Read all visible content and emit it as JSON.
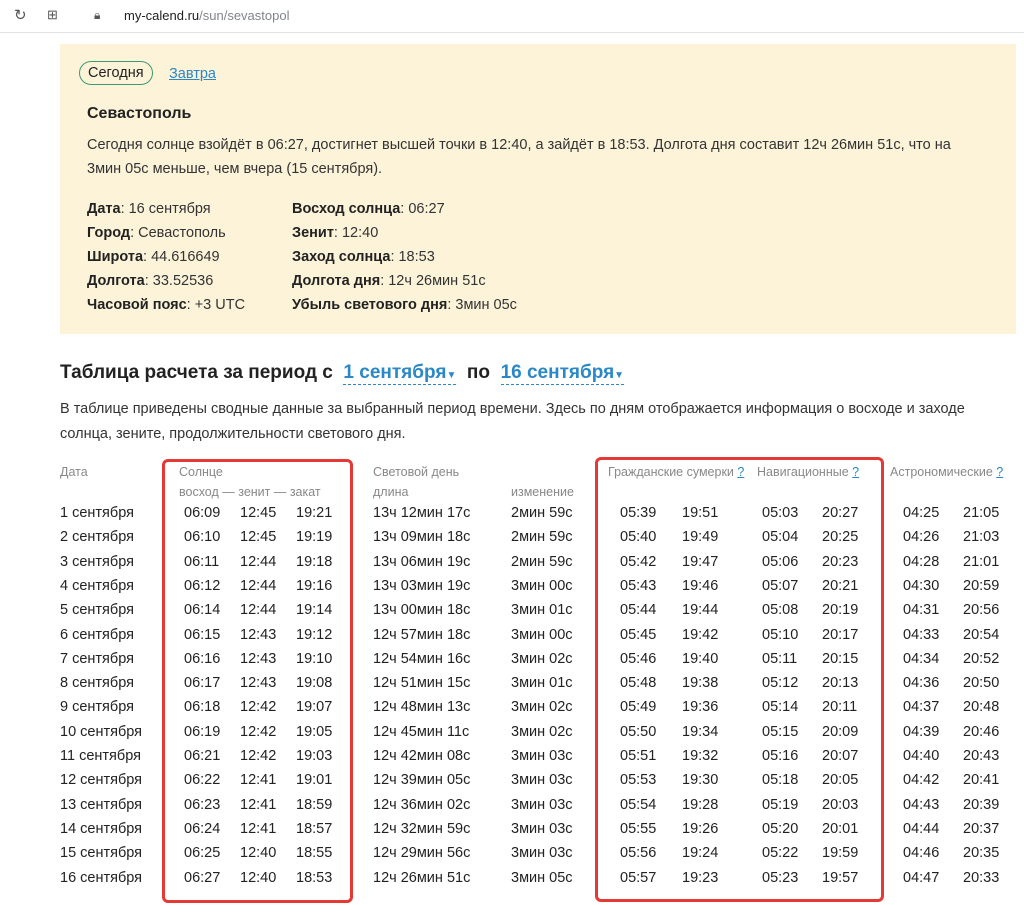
{
  "browser": {
    "url_host": "my-calend.ru",
    "url_path": "/sun/sevastopol"
  },
  "tabs": {
    "today": "Сегодня",
    "tomorrow": "Завтра"
  },
  "info": {
    "city": "Севастополь",
    "description": "Сегодня солнце взойдёт в 06:27, достигнет высшей точки в 12:40, а зайдёт в 18:53. Долгота дня составит 12ч 26мин 51с, что на 3мин 05с меньше, чем вчера (15 сентября).",
    "left": [
      {
        "label": "Дата",
        "value": ": 16 сентября"
      },
      {
        "label": "Город",
        "value": ": Севастополь"
      },
      {
        "label": "Широта",
        "value": ": 44.616649"
      },
      {
        "label": "Долгота",
        "value": ": 33.52536"
      },
      {
        "label": "Часовой пояс",
        "value": ": +3 UTC"
      }
    ],
    "right": [
      {
        "label": "Восход солнца",
        "value": ": 06:27"
      },
      {
        "label": "Зенит",
        "value": ": 12:40"
      },
      {
        "label": "Заход солнца",
        "value": ": 18:53"
      },
      {
        "label": "Долгота дня",
        "value": ": 12ч 26мин 51с"
      },
      {
        "label": "Убыль светового дня",
        "value": ": 3мин 05с"
      }
    ]
  },
  "period": {
    "title": "Таблица расчета за период с",
    "from": "1 сентября",
    "to_word": "по",
    "to": "16 сентября",
    "intro": "В таблице приведены сводные данные за выбранный период времени. Здесь по дням отображается информация о восходе и заходе солнца, зените, продолжительности светового дня."
  },
  "table_headers": {
    "date": "Дата",
    "sun": "Солнце",
    "sun_sub": "восход — зенит — закат",
    "daylight": "Световой день",
    "length": "длина",
    "change": "изменение",
    "civil": "Гражданские сумерки",
    "nautical": "Навигационные",
    "astronomical": "Астрономические",
    "help": "?"
  },
  "rows": [
    [
      "1 сентября",
      "06:09",
      "12:45",
      "19:21",
      "13ч 12мин 17с",
      "2мин 59с",
      "05:39",
      "19:51",
      "05:03",
      "20:27",
      "04:25",
      "21:05"
    ],
    [
      "2 сентября",
      "06:10",
      "12:45",
      "19:19",
      "13ч 09мин 18с",
      "2мин 59с",
      "05:40",
      "19:49",
      "05:04",
      "20:25",
      "04:26",
      "21:03"
    ],
    [
      "3 сентября",
      "06:11",
      "12:44",
      "19:18",
      "13ч 06мин 19с",
      "2мин 59с",
      "05:42",
      "19:47",
      "05:06",
      "20:23",
      "04:28",
      "21:01"
    ],
    [
      "4 сентября",
      "06:12",
      "12:44",
      "19:16",
      "13ч 03мин 19с",
      "3мин 00с",
      "05:43",
      "19:46",
      "05:07",
      "20:21",
      "04:30",
      "20:59"
    ],
    [
      "5 сентября",
      "06:14",
      "12:44",
      "19:14",
      "13ч 00мин 18с",
      "3мин 01с",
      "05:44",
      "19:44",
      "05:08",
      "20:19",
      "04:31",
      "20:56"
    ],
    [
      "6 сентября",
      "06:15",
      "12:43",
      "19:12",
      "12ч 57мин 18с",
      "3мин 00с",
      "05:45",
      "19:42",
      "05:10",
      "20:17",
      "04:33",
      "20:54"
    ],
    [
      "7 сентября",
      "06:16",
      "12:43",
      "19:10",
      "12ч 54мин 16с",
      "3мин 02с",
      "05:46",
      "19:40",
      "05:11",
      "20:15",
      "04:34",
      "20:52"
    ],
    [
      "8 сентября",
      "06:17",
      "12:43",
      "19:08",
      "12ч 51мин 15с",
      "3мин 01с",
      "05:48",
      "19:38",
      "05:12",
      "20:13",
      "04:36",
      "20:50"
    ],
    [
      "9 сентября",
      "06:18",
      "12:42",
      "19:07",
      "12ч 48мин 13с",
      "3мин 02с",
      "05:49",
      "19:36",
      "05:14",
      "20:11",
      "04:37",
      "20:48"
    ],
    [
      "10 сентября",
      "06:19",
      "12:42",
      "19:05",
      "12ч 45мин 11с",
      "3мин 02с",
      "05:50",
      "19:34",
      "05:15",
      "20:09",
      "04:39",
      "20:46"
    ],
    [
      "11 сентября",
      "06:21",
      "12:42",
      "19:03",
      "12ч 42мин 08с",
      "3мин 03с",
      "05:51",
      "19:32",
      "05:16",
      "20:07",
      "04:40",
      "20:43"
    ],
    [
      "12 сентября",
      "06:22",
      "12:41",
      "19:01",
      "12ч 39мин 05с",
      "3мин 03с",
      "05:53",
      "19:30",
      "05:18",
      "20:05",
      "04:42",
      "20:41"
    ],
    [
      "13 сентября",
      "06:23",
      "12:41",
      "18:59",
      "12ч 36мин 02с",
      "3мин 03с",
      "05:54",
      "19:28",
      "05:19",
      "20:03",
      "04:43",
      "20:39"
    ],
    [
      "14 сентября",
      "06:24",
      "12:41",
      "18:57",
      "12ч 32мин 59с",
      "3мин 03с",
      "05:55",
      "19:26",
      "05:20",
      "20:01",
      "04:44",
      "20:37"
    ],
    [
      "15 сентября",
      "06:25",
      "12:40",
      "18:55",
      "12ч 29мин 56с",
      "3мин 03с",
      "05:56",
      "19:24",
      "05:22",
      "19:59",
      "04:46",
      "20:35"
    ],
    [
      "16 сентября",
      "06:27",
      "12:40",
      "18:53",
      "12ч 26мин 51с",
      "3мин 05с",
      "05:57",
      "19:23",
      "05:23",
      "19:57",
      "04:47",
      "20:33"
    ]
  ]
}
